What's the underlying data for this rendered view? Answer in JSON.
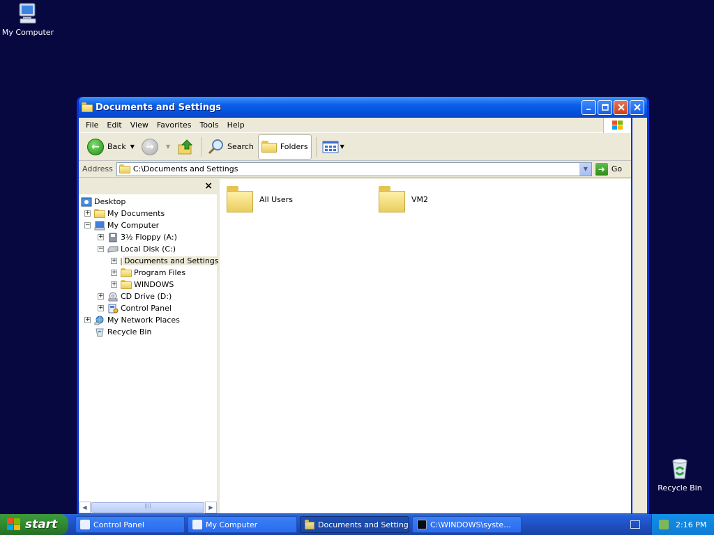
{
  "desktop": {
    "icons": [
      {
        "label": "My Computer",
        "icon": "my-computer-icon"
      },
      {
        "label": "Recycle Bin",
        "icon": "recycle-bin-icon"
      }
    ]
  },
  "window": {
    "title": "Documents and Settings",
    "menu": [
      "File",
      "Edit",
      "View",
      "Favorites",
      "Tools",
      "Help"
    ],
    "toolbar": {
      "back_label": "Back",
      "search_label": "Search",
      "folders_label": "Folders"
    },
    "address": {
      "label": "Address",
      "value": "C:\\Documents and Settings",
      "go_label": "Go"
    },
    "folders_pane": {
      "close_glyph": "×",
      "tree": [
        {
          "label": "Desktop",
          "expander": "",
          "icon": "desktop-icon"
        },
        {
          "label": "My Documents",
          "expander": "+",
          "icon": "my-documents-icon"
        },
        {
          "label": "My Computer",
          "expander": "−",
          "icon": "my-computer-icon"
        },
        {
          "label": "3½ Floppy (A:)",
          "expander": "+",
          "icon": "floppy-icon"
        },
        {
          "label": "Local Disk (C:)",
          "expander": "−",
          "icon": "disk-icon"
        },
        {
          "label": "Documents and Settings",
          "expander": "+",
          "icon": "folder-icon"
        },
        {
          "label": "Program Files",
          "expander": "+",
          "icon": "folder-icon"
        },
        {
          "label": "WINDOWS",
          "expander": "+",
          "icon": "folder-icon"
        },
        {
          "label": "CD Drive (D:)",
          "expander": "+",
          "icon": "cd-drive-icon"
        },
        {
          "label": "Control Panel",
          "expander": "+",
          "icon": "control-panel-icon"
        },
        {
          "label": "My Network Places",
          "expander": "+",
          "icon": "network-icon"
        },
        {
          "label": "Recycle Bin",
          "expander": "",
          "icon": "recycle-bin-icon"
        }
      ]
    },
    "content": {
      "items": [
        {
          "label": "All Users",
          "icon": "folder-icon"
        },
        {
          "label": "VM2",
          "icon": "folder-icon"
        }
      ]
    }
  },
  "taskbar": {
    "start_label": "start",
    "tasks": [
      {
        "label": "Control Panel"
      },
      {
        "label": "My Computer"
      },
      {
        "label": "Documents and Settings"
      },
      {
        "label": "C:\\WINDOWS\\syste..."
      }
    ],
    "clock": "2:16 PM"
  }
}
